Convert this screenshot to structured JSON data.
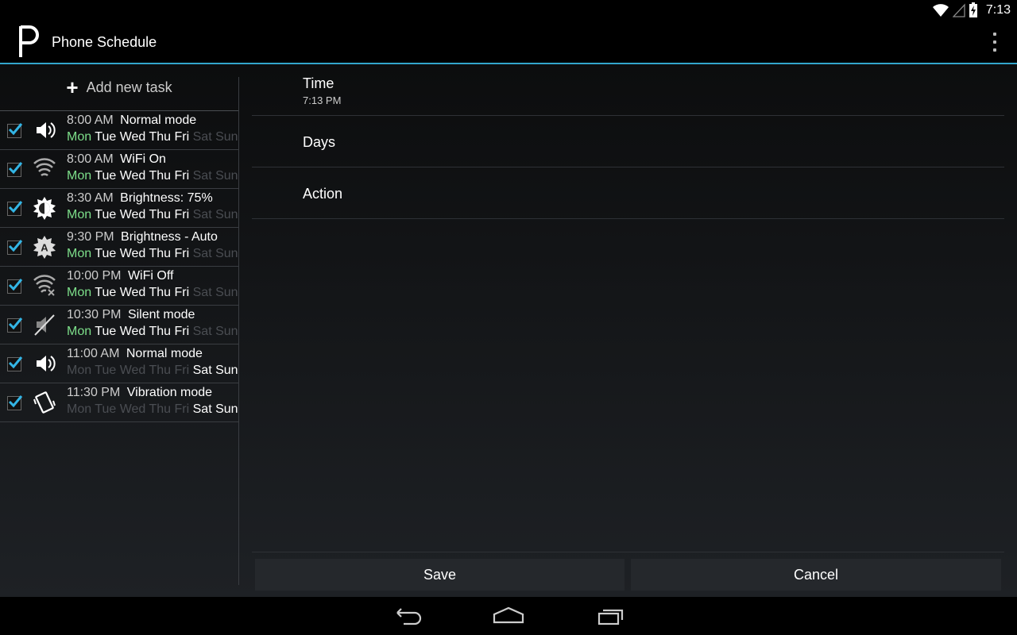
{
  "status_bar": {
    "time": "7:13",
    "icons": [
      "wifi-icon",
      "signal-icon",
      "battery-charging-icon"
    ]
  },
  "action_bar": {
    "title": "Phone Schedule",
    "logo_letter": "P",
    "overflow_icon": "overflow-menu-icon"
  },
  "left_pane": {
    "add_task_label": "Add new task",
    "tasks": [
      {
        "time": "8:00 AM",
        "name": "Normal mode",
        "icon": "volume-icon",
        "checked": true,
        "days": [
          {
            "d": "Mon",
            "s": "today"
          },
          {
            "d": "Tue",
            "s": "on"
          },
          {
            "d": "Wed",
            "s": "on"
          },
          {
            "d": "Thu",
            "s": "on"
          },
          {
            "d": "Fri",
            "s": "on"
          },
          {
            "d": "Sat",
            "s": "off"
          },
          {
            "d": "Sun",
            "s": "off"
          }
        ]
      },
      {
        "time": "8:00 AM",
        "name": "WiFi On",
        "icon": "wifi-icon",
        "checked": true,
        "days": [
          {
            "d": "Mon",
            "s": "today"
          },
          {
            "d": "Tue",
            "s": "on"
          },
          {
            "d": "Wed",
            "s": "on"
          },
          {
            "d": "Thu",
            "s": "on"
          },
          {
            "d": "Fri",
            "s": "on"
          },
          {
            "d": "Sat",
            "s": "off"
          },
          {
            "d": "Sun",
            "s": "off"
          }
        ]
      },
      {
        "time": "8:30 AM",
        "name": "Brightness: 75%",
        "icon": "brightness-icon",
        "checked": true,
        "days": [
          {
            "d": "Mon",
            "s": "today"
          },
          {
            "d": "Tue",
            "s": "on"
          },
          {
            "d": "Wed",
            "s": "on"
          },
          {
            "d": "Thu",
            "s": "on"
          },
          {
            "d": "Fri",
            "s": "on"
          },
          {
            "d": "Sat",
            "s": "off"
          },
          {
            "d": "Sun",
            "s": "off"
          }
        ]
      },
      {
        "time": "9:30 PM",
        "name": "Brightness - Auto",
        "icon": "brightness-auto-icon",
        "checked": true,
        "days": [
          {
            "d": "Mon",
            "s": "today"
          },
          {
            "d": "Tue",
            "s": "on"
          },
          {
            "d": "Wed",
            "s": "on"
          },
          {
            "d": "Thu",
            "s": "on"
          },
          {
            "d": "Fri",
            "s": "on"
          },
          {
            "d": "Sat",
            "s": "off"
          },
          {
            "d": "Sun",
            "s": "off"
          }
        ]
      },
      {
        "time": "10:00 PM",
        "name": "WiFi Off",
        "icon": "wifi-off-icon",
        "checked": true,
        "days": [
          {
            "d": "Mon",
            "s": "today"
          },
          {
            "d": "Tue",
            "s": "on"
          },
          {
            "d": "Wed",
            "s": "on"
          },
          {
            "d": "Thu",
            "s": "on"
          },
          {
            "d": "Fri",
            "s": "on"
          },
          {
            "d": "Sat",
            "s": "off"
          },
          {
            "d": "Sun",
            "s": "off"
          }
        ]
      },
      {
        "time": "10:30 PM",
        "name": "Silent mode",
        "icon": "silent-icon",
        "checked": true,
        "days": [
          {
            "d": "Mon",
            "s": "today"
          },
          {
            "d": "Tue",
            "s": "on"
          },
          {
            "d": "Wed",
            "s": "on"
          },
          {
            "d": "Thu",
            "s": "on"
          },
          {
            "d": "Fri",
            "s": "on"
          },
          {
            "d": "Sat",
            "s": "off"
          },
          {
            "d": "Sun",
            "s": "off"
          }
        ]
      },
      {
        "time": "11:00 AM",
        "name": "Normal mode",
        "icon": "volume-icon",
        "checked": true,
        "days": [
          {
            "d": "Mon",
            "s": "off"
          },
          {
            "d": "Tue",
            "s": "off"
          },
          {
            "d": "Wed",
            "s": "off"
          },
          {
            "d": "Thu",
            "s": "off"
          },
          {
            "d": "Fri",
            "s": "off"
          },
          {
            "d": "Sat",
            "s": "on"
          },
          {
            "d": "Sun",
            "s": "on"
          }
        ]
      },
      {
        "time": "11:30 PM",
        "name": "Vibration mode",
        "icon": "vibrate-icon",
        "checked": true,
        "days": [
          {
            "d": "Mon",
            "s": "off"
          },
          {
            "d": "Tue",
            "s": "off"
          },
          {
            "d": "Wed",
            "s": "off"
          },
          {
            "d": "Thu",
            "s": "off"
          },
          {
            "d": "Fri",
            "s": "off"
          },
          {
            "d": "Sat",
            "s": "on"
          },
          {
            "d": "Sun",
            "s": "on"
          }
        ]
      }
    ]
  },
  "detail": {
    "time_label": "Time",
    "time_value": "7:13 PM",
    "days_label": "Days",
    "action_label": "Action",
    "save_label": "Save",
    "cancel_label": "Cancel"
  },
  "colors": {
    "accent": "#33a5cc",
    "today": "#7ddf8a",
    "day_on": "#ffffff",
    "day_off": "#4a4d52"
  },
  "nav_bar": {
    "icons": [
      "back-icon",
      "home-icon",
      "recent-apps-icon"
    ]
  }
}
